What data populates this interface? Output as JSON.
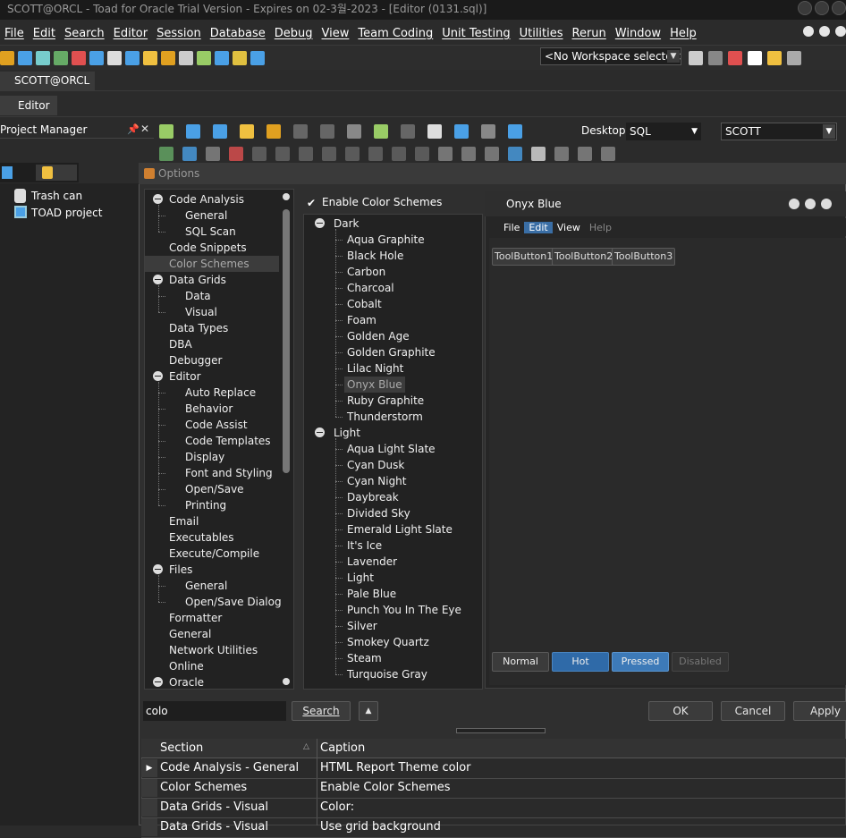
{
  "app": {
    "title": "SCOTT@ORCL - Toad for Oracle Trial Version - Expires on 02-3월-2023 - [Editor (0131.sql)]"
  },
  "menu": [
    "File",
    "Edit",
    "Search",
    "Editor",
    "Session",
    "Database",
    "Debug",
    "View",
    "Team Coding",
    "Unit Testing",
    "Utilities",
    "Rerun",
    "Window",
    "Help"
  ],
  "toolbar": {
    "workspace": "<No Workspace selected>"
  },
  "connection_tab": "SCOTT@ORCL",
  "editor_tab": "Editor",
  "project_manager": {
    "title": "Project Manager",
    "items": [
      "Trash can",
      "TOAD project"
    ]
  },
  "editor_toolbar": {
    "desktop_label": "Desktop:",
    "desktop_value": "SQL",
    "schema_value": "SCOTT"
  },
  "dialog": {
    "title": "Options",
    "tree": [
      {
        "label": "Code Analysis",
        "level": 0,
        "expand": true
      },
      {
        "label": "General",
        "level": 1
      },
      {
        "label": "SQL Scan",
        "level": 1
      },
      {
        "label": "Code Snippets",
        "level": 0
      },
      {
        "label": "Color Schemes",
        "level": 0,
        "selected": true
      },
      {
        "label": "Data Grids",
        "level": 0,
        "expand": true
      },
      {
        "label": "Data",
        "level": 1
      },
      {
        "label": "Visual",
        "level": 1
      },
      {
        "label": "Data Types",
        "level": 0
      },
      {
        "label": "DBA",
        "level": 0
      },
      {
        "label": "Debugger",
        "level": 0
      },
      {
        "label": "Editor",
        "level": 0,
        "expand": true
      },
      {
        "label": "Auto Replace",
        "level": 1
      },
      {
        "label": "Behavior",
        "level": 1
      },
      {
        "label": "Code Assist",
        "level": 1
      },
      {
        "label": "Code Templates",
        "level": 1
      },
      {
        "label": "Display",
        "level": 1
      },
      {
        "label": "Font and Styling",
        "level": 1
      },
      {
        "label": "Open/Save",
        "level": 1
      },
      {
        "label": "Printing",
        "level": 1
      },
      {
        "label": "Email",
        "level": 0
      },
      {
        "label": "Executables",
        "level": 0
      },
      {
        "label": "Execute/Compile",
        "level": 0
      },
      {
        "label": "Files",
        "level": 0,
        "expand": true
      },
      {
        "label": "General",
        "level": 1
      },
      {
        "label": "Open/Save Dialogs",
        "level": 1
      },
      {
        "label": "Formatter",
        "level": 0
      },
      {
        "label": "General",
        "level": 0
      },
      {
        "label": "Network Utilities",
        "level": 0
      },
      {
        "label": "Online",
        "level": 0
      },
      {
        "label": "Oracle",
        "level": 0,
        "expand": true
      }
    ],
    "enable_color_schemes": "Enable Color Schemes",
    "schemes": [
      {
        "label": "Dark",
        "level": 0,
        "expand": true
      },
      {
        "label": "Aqua Graphite",
        "level": 1
      },
      {
        "label": "Black Hole",
        "level": 1
      },
      {
        "label": "Carbon",
        "level": 1
      },
      {
        "label": "Charcoal",
        "level": 1
      },
      {
        "label": "Cobalt",
        "level": 1
      },
      {
        "label": "Foam",
        "level": 1
      },
      {
        "label": "Golden Age",
        "level": 1
      },
      {
        "label": "Golden Graphite",
        "level": 1
      },
      {
        "label": "Lilac Night",
        "level": 1
      },
      {
        "label": "Onyx Blue",
        "level": 1,
        "selected": true
      },
      {
        "label": "Ruby Graphite",
        "level": 1
      },
      {
        "label": "Thunderstorm",
        "level": 1
      },
      {
        "label": "Light",
        "level": 0,
        "expand": true
      },
      {
        "label": "Aqua Light Slate",
        "level": 1
      },
      {
        "label": "Cyan Dusk",
        "level": 1
      },
      {
        "label": "Cyan Night",
        "level": 1
      },
      {
        "label": "Daybreak",
        "level": 1
      },
      {
        "label": "Divided Sky",
        "level": 1
      },
      {
        "label": "Emerald Light Slate",
        "level": 1
      },
      {
        "label": "It's Ice",
        "level": 1
      },
      {
        "label": "Lavender",
        "level": 1
      },
      {
        "label": "Light",
        "level": 1
      },
      {
        "label": "Pale Blue",
        "level": 1
      },
      {
        "label": "Punch You In The Eye",
        "level": 1
      },
      {
        "label": "Silver",
        "level": 1
      },
      {
        "label": "Smokey Quartz",
        "level": 1
      },
      {
        "label": "Steam",
        "level": 1
      },
      {
        "label": "Turquoise Gray",
        "level": 1
      }
    ],
    "preview": {
      "title": "Onyx Blue",
      "menu": [
        "File",
        "Edit",
        "View",
        "Help"
      ],
      "tool_buttons": [
        "ToolButton1",
        "ToolButton2",
        "ToolButton3"
      ],
      "states": [
        "Normal",
        "Hot",
        "Pressed",
        "Disabled"
      ]
    },
    "search_value": "colo",
    "search_button": "Search",
    "ok": "OK",
    "cancel": "Cancel",
    "apply": "Apply",
    "results": {
      "headers": [
        "Section",
        "Caption"
      ],
      "rows": [
        [
          "Code Analysis - General",
          "HTML Report Theme color"
        ],
        [
          "Color Schemes",
          "Enable Color Schemes"
        ],
        [
          "Data Grids - Visual",
          "Color:"
        ],
        [
          "Data Grids - Visual",
          "Use grid background"
        ]
      ]
    }
  },
  "colors": {
    "accent": "#3a6ea5",
    "hot": "#2f6aa8",
    "pressed": "#3d7ab8"
  }
}
